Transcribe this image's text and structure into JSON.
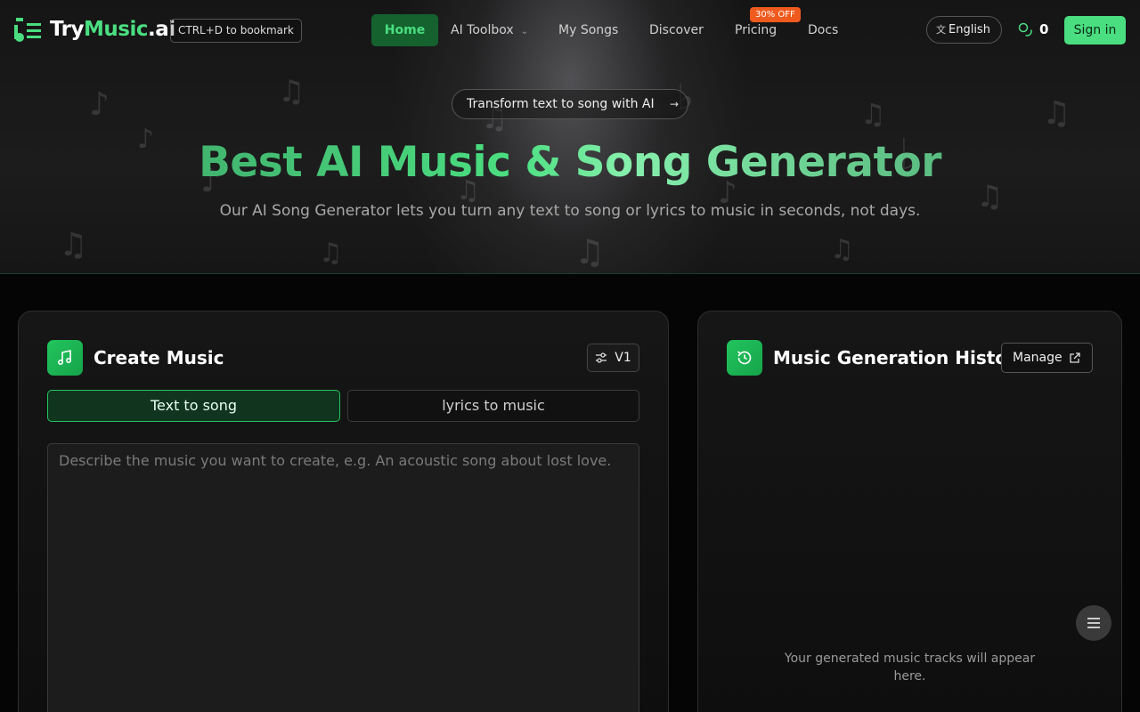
{
  "brand": {
    "name_part1": "Try",
    "name_part2": "Music",
    "name_part3": ".ai",
    "accent": "#4ade80"
  },
  "header": {
    "bookmark_hint": "CTRL+D to bookmark",
    "nav": {
      "home": "Home",
      "ai_toolbox": "AI Toolbox",
      "my_songs": "My Songs",
      "discover": "Discover",
      "pricing": "Pricing",
      "docs": "Docs"
    },
    "pricing_badge": "30% OFF",
    "language": "English",
    "credits": "0",
    "sign_in": "Sign in"
  },
  "hero": {
    "pill": "Transform text to song with AI",
    "title": "Best AI Music & Song Generator",
    "subtitle": "Our AI Song Generator lets you turn any text to song or lyrics to music in seconds, not days."
  },
  "create": {
    "title": "Create Music",
    "version": "V1",
    "tabs": [
      "Text to song",
      "lyrics to music"
    ],
    "prompt_placeholder": "Describe the music you want to create, e.g. An acoustic song about lost love.",
    "prompt_value": ""
  },
  "history": {
    "title": "Music Generation History",
    "manage": "Manage",
    "empty": "Your generated music tracks will appear here."
  }
}
